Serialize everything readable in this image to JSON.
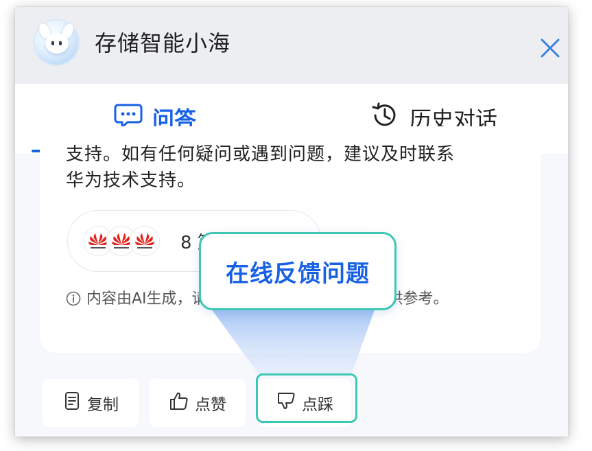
{
  "header": {
    "title": "存储智能小海",
    "close_icon": "close-icon"
  },
  "tabs": [
    {
      "label": "问答",
      "icon": "chat-icon",
      "active": true
    },
    {
      "label": "历史对话",
      "icon": "history-icon",
      "active": false
    }
  ],
  "answer": {
    "clipped_text": "支持。如有任何疑问或遇到问题，建议及时联系",
    "last_line": "华为技术支持。"
  },
  "sources": {
    "logo_icon": "huawei-logo-icon",
    "logo_count": 3,
    "label": "8 篇引用来源"
  },
  "disclaimer": {
    "icon": "info-icon",
    "text": "内容由AI生成，请注意甄别内容的准确性，仅供参考。"
  },
  "actions": [
    {
      "label": "复制",
      "icon": "copy-icon"
    },
    {
      "label": "点赞",
      "icon": "thumbs-up-icon"
    },
    {
      "label": "点踩",
      "icon": "thumbs-down-icon"
    }
  ],
  "callout": {
    "label": "在线反馈问题"
  },
  "colors": {
    "accent": "#1761e5",
    "highlight": "#3cc8b4",
    "huawei_red": "#e2231a"
  }
}
